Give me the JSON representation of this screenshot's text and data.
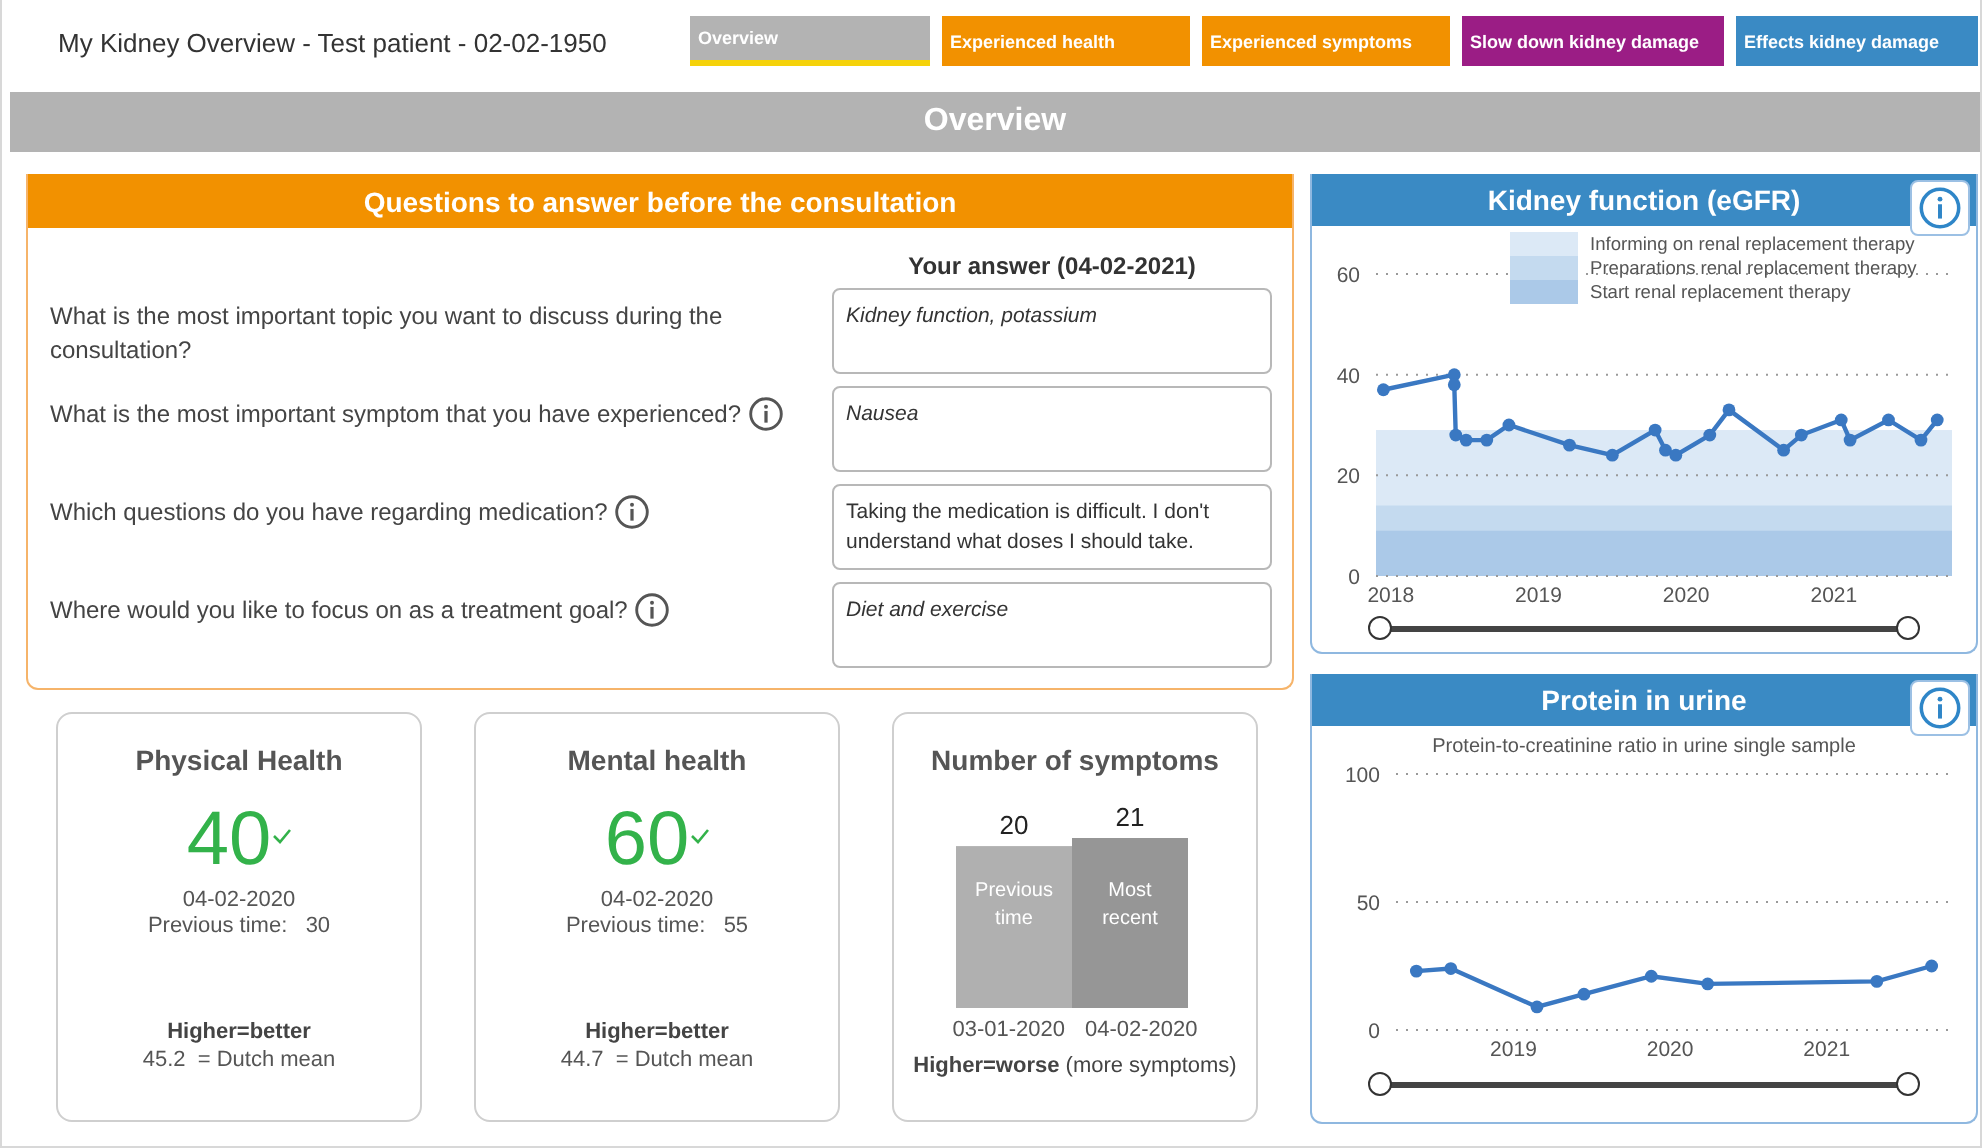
{
  "header": {
    "title": "My Kidney Overview - Test patient - 02-02-1950"
  },
  "tabs": [
    {
      "label": "Overview",
      "selected": true,
      "color": "#b3b3b3"
    },
    {
      "label": "Experienced health",
      "selected": false,
      "color": "#f29100"
    },
    {
      "label": "Experienced symptoms",
      "selected": false,
      "color": "#f29100"
    },
    {
      "label": "Slow down kidney damage",
      "selected": false,
      "color": "#9b1d85"
    },
    {
      "label": "Effects kidney damage",
      "selected": false,
      "color": "#3a8ac4"
    }
  ],
  "page_title": "Overview",
  "questions_panel": {
    "title": "Questions to answer before the consultation",
    "answer_heading": "Your answer (04-02-2021)",
    "questions": [
      {
        "question": "What is the most important topic you want to discuss during the consultation?",
        "info": false,
        "answer": "Kidney function, potassium",
        "italic": true
      },
      {
        "question": "What is the most important symptom that you have experienced?",
        "info": true,
        "answer": "Nausea",
        "italic": true
      },
      {
        "question": "Which questions do you have regarding medication?",
        "info": true,
        "answer": "Taking the medication is difficult. I don't understand what doses I should take.",
        "italic": false
      },
      {
        "question": "Where would you like to focus on as a treatment goal?",
        "info": true,
        "answer": "Diet and exercise",
        "italic": true
      }
    ]
  },
  "score_cards": [
    {
      "title": "Physical Health",
      "score": "40",
      "date": "04-02-2020",
      "previous_label": "Previous time:",
      "previous_value": "30",
      "rule": "Higher=better",
      "mean_value": "45.2",
      "mean_label": "= Dutch mean"
    },
    {
      "title": "Mental health",
      "score": "60",
      "date": "04-02-2020",
      "previous_label": "Previous time:",
      "previous_value": "55",
      "rule": "Higher=better",
      "mean_value": "44.7",
      "mean_label": "= Dutch mean"
    }
  ],
  "symptoms_card": {
    "title": "Number of symptoms",
    "chart_data": {
      "type": "bar",
      "categories": [
        "Previous time",
        "Most recent"
      ],
      "series": [
        {
          "color": "#b0b0b0",
          "values": [
            20,
            null
          ]
        },
        {
          "color": "#969696",
          "values": [
            null,
            21
          ]
        }
      ],
      "ylim": [
        0,
        21
      ],
      "data_labels": true
    },
    "dates": [
      "03-01-2020",
      "04-02-2020"
    ],
    "rule": "Higher=worse",
    "rule_note": "(more symptoms)"
  },
  "egfr_panel": {
    "title": "Kidney function (eGFR)",
    "slider": {
      "level": 1
    },
    "chart_data": {
      "type": "line",
      "x": [
        2017.95,
        2018.43,
        2018.43,
        2018.44,
        2018.51,
        2018.65,
        2018.8,
        2019.21,
        2019.5,
        2019.79,
        2019.86,
        2019.93,
        2020.16,
        2020.29,
        2020.66,
        2020.78,
        2021.05,
        2021.11,
        2021.37,
        2021.59,
        2021.7
      ],
      "series": [
        {
          "color": "#3a78c2",
          "marker": "circle",
          "values": [
            37,
            40,
            38,
            28,
            27,
            27,
            30,
            26,
            24,
            29,
            25,
            24,
            28,
            33,
            25,
            28,
            31,
            27,
            31,
            27,
            31
          ]
        }
      ],
      "xlim": [
        2017.9,
        2021.8
      ],
      "ylim": [
        0,
        60
      ],
      "yticks": [
        0,
        20,
        40,
        60
      ],
      "grid": true,
      "legend": "top",
      "xticks": [
        {
          "value": 2018,
          "label": "2018"
        },
        {
          "value": 2019,
          "label": "2019"
        },
        {
          "value": 2020,
          "label": "2020"
        },
        {
          "value": 2021,
          "label": "2021"
        }
      ],
      "bands": [
        {
          "axis": "y",
          "from": 0,
          "to": 29,
          "color": "#dce9f6",
          "label": "Informing on renal replacement therapy"
        },
        {
          "axis": "y",
          "from": 0,
          "to": 14,
          "color": "#c4daef",
          "label": "Preparations renal replacement therapy"
        },
        {
          "axis": "y",
          "from": 0,
          "to": 9,
          "color": "#abc9e8",
          "label": "Start renal replacement therapy"
        }
      ]
    }
  },
  "protein_panel": {
    "title": "Protein in urine",
    "slider": {
      "level": 1
    },
    "chart_data": {
      "type": "line",
      "title": "Protein-to-creatinine ratio in urine single sample",
      "x": [
        2018.38,
        2018.6,
        2019.15,
        2019.45,
        2019.88,
        2020.24,
        2021.32,
        2021.67
      ],
      "series": [
        {
          "color": "#3a78c2",
          "marker": "circle",
          "values": [
            23,
            24,
            9,
            14,
            21,
            18,
            19,
            25
          ]
        }
      ],
      "xlim": [
        2018.25,
        2021.8
      ],
      "ylim": [
        0,
        100
      ],
      "yticks": [
        0,
        50,
        100
      ],
      "grid": true,
      "xticks": [
        {
          "value": 2019,
          "label": "2019"
        },
        {
          "value": 2020,
          "label": "2020"
        },
        {
          "value": 2021,
          "label": "2021"
        }
      ]
    }
  }
}
